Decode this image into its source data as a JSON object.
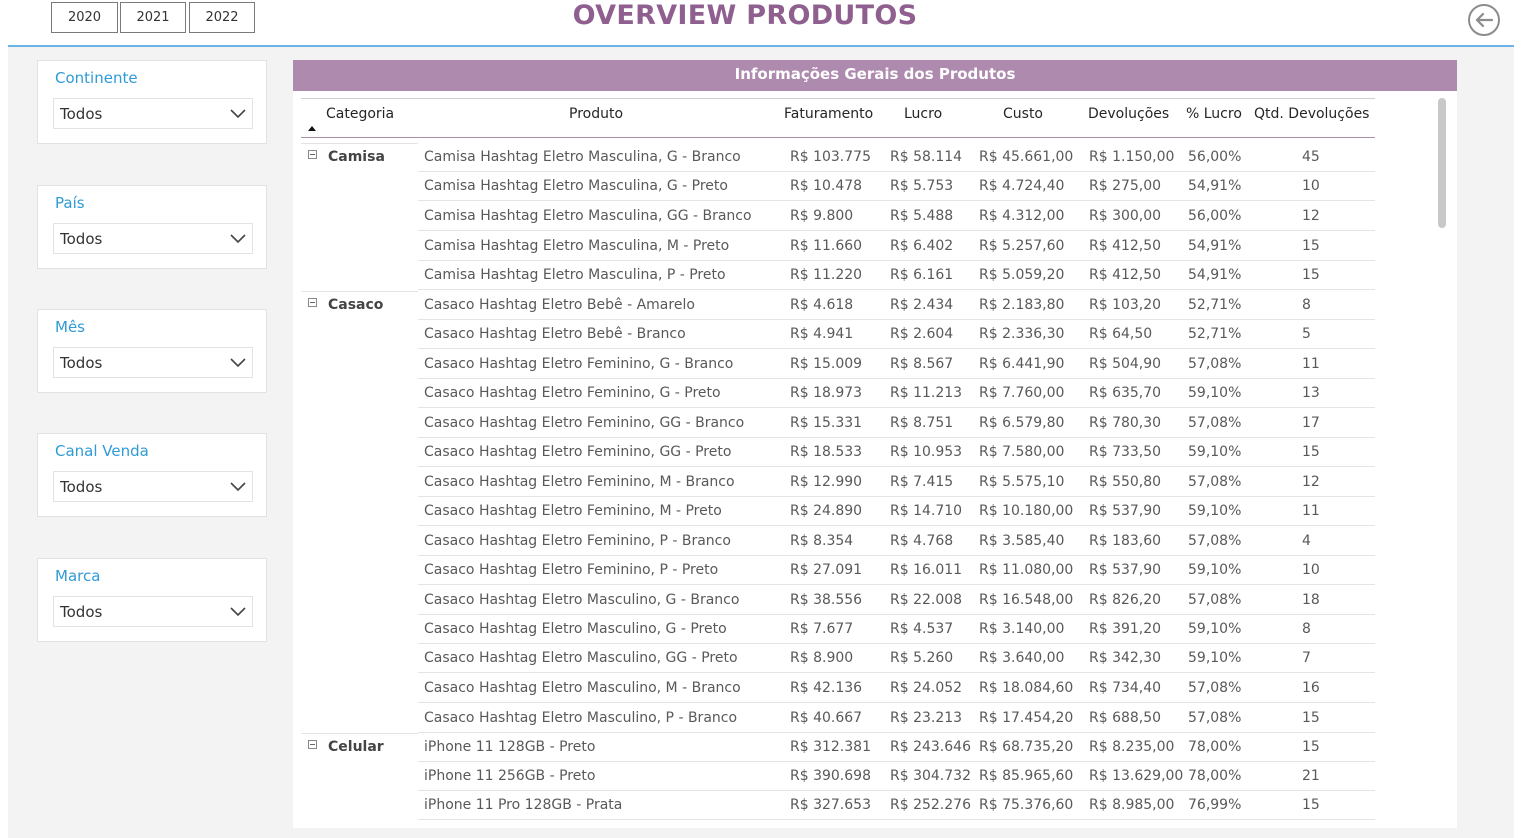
{
  "header": {
    "years": [
      "2020",
      "2021",
      "2022"
    ],
    "title": "OVERVIEW PRODUTOS"
  },
  "filters": [
    {
      "label": "Continente",
      "value": "Todos"
    },
    {
      "label": "País",
      "value": "Todos"
    },
    {
      "label": "Mês",
      "value": "Todos"
    },
    {
      "label": "Canal Venda",
      "value": "Todos"
    },
    {
      "label": "Marca",
      "value": "Todos"
    }
  ],
  "table": {
    "title": "Informações Gerais dos Produtos",
    "columns": [
      "Categoria",
      "Produto",
      "Faturamento",
      "Lucro",
      "Custo",
      "Devoluções",
      "% Lucro",
      "Qtd. Devoluções"
    ],
    "rows": [
      {
        "categoria": "Camisa",
        "produto": "Camisa Hashtag Eletro Masculina, G - Branco",
        "faturamento": "R$ 103.775",
        "lucro": "R$ 58.114",
        "custo": "R$ 45.661,00",
        "devolucoes": "R$ 1.150,00",
        "pct_lucro": "56,00%",
        "qtd_dev": "45"
      },
      {
        "categoria": "",
        "produto": "Camisa Hashtag Eletro Masculina, G - Preto",
        "faturamento": "R$ 10.478",
        "lucro": "R$ 5.753",
        "custo": "R$ 4.724,40",
        "devolucoes": "R$ 275,00",
        "pct_lucro": "54,91%",
        "qtd_dev": "10"
      },
      {
        "categoria": "",
        "produto": "Camisa Hashtag Eletro Masculina, GG - Branco",
        "faturamento": "R$ 9.800",
        "lucro": "R$ 5.488",
        "custo": "R$ 4.312,00",
        "devolucoes": "R$ 300,00",
        "pct_lucro": "56,00%",
        "qtd_dev": "12"
      },
      {
        "categoria": "",
        "produto": "Camisa Hashtag Eletro Masculina, M - Preto",
        "faturamento": "R$ 11.660",
        "lucro": "R$ 6.402",
        "custo": "R$ 5.257,60",
        "devolucoes": "R$ 412,50",
        "pct_lucro": "54,91%",
        "qtd_dev": "15"
      },
      {
        "categoria": "",
        "produto": "Camisa Hashtag Eletro Masculina, P - Preto",
        "faturamento": "R$ 11.220",
        "lucro": "R$ 6.161",
        "custo": "R$ 5.059,20",
        "devolucoes": "R$ 412,50",
        "pct_lucro": "54,91%",
        "qtd_dev": "15"
      },
      {
        "categoria": "Casaco",
        "produto": "Casaco Hashtag Eletro Bebê - Amarelo",
        "faturamento": "R$ 4.618",
        "lucro": "R$ 2.434",
        "custo": "R$ 2.183,80",
        "devolucoes": "R$ 103,20",
        "pct_lucro": "52,71%",
        "qtd_dev": "8"
      },
      {
        "categoria": "",
        "produto": "Casaco Hashtag Eletro Bebê - Branco",
        "faturamento": "R$ 4.941",
        "lucro": "R$ 2.604",
        "custo": "R$ 2.336,30",
        "devolucoes": "R$ 64,50",
        "pct_lucro": "52,71%",
        "qtd_dev": "5"
      },
      {
        "categoria": "",
        "produto": "Casaco Hashtag Eletro Feminino, G - Branco",
        "faturamento": "R$ 15.009",
        "lucro": "R$ 8.567",
        "custo": "R$ 6.441,90",
        "devolucoes": "R$ 504,90",
        "pct_lucro": "57,08%",
        "qtd_dev": "11"
      },
      {
        "categoria": "",
        "produto": "Casaco Hashtag Eletro Feminino, G - Preto",
        "faturamento": "R$ 18.973",
        "lucro": "R$ 11.213",
        "custo": "R$ 7.760,00",
        "devolucoes": "R$ 635,70",
        "pct_lucro": "59,10%",
        "qtd_dev": "13"
      },
      {
        "categoria": "",
        "produto": "Casaco Hashtag Eletro Feminino, GG - Branco",
        "faturamento": "R$ 15.331",
        "lucro": "R$ 8.751",
        "custo": "R$ 6.579,80",
        "devolucoes": "R$ 780,30",
        "pct_lucro": "57,08%",
        "qtd_dev": "17"
      },
      {
        "categoria": "",
        "produto": "Casaco Hashtag Eletro Feminino, GG - Preto",
        "faturamento": "R$ 18.533",
        "lucro": "R$ 10.953",
        "custo": "R$ 7.580,00",
        "devolucoes": "R$ 733,50",
        "pct_lucro": "59,10%",
        "qtd_dev": "15"
      },
      {
        "categoria": "",
        "produto": "Casaco Hashtag Eletro Feminino, M - Branco",
        "faturamento": "R$ 12.990",
        "lucro": "R$ 7.415",
        "custo": "R$ 5.575,10",
        "devolucoes": "R$ 550,80",
        "pct_lucro": "57,08%",
        "qtd_dev": "12"
      },
      {
        "categoria": "",
        "produto": "Casaco Hashtag Eletro Feminino, M - Preto",
        "faturamento": "R$ 24.890",
        "lucro": "R$ 14.710",
        "custo": "R$ 10.180,00",
        "devolucoes": "R$ 537,90",
        "pct_lucro": "59,10%",
        "qtd_dev": "11"
      },
      {
        "categoria": "",
        "produto": "Casaco Hashtag Eletro Feminino, P - Branco",
        "faturamento": "R$ 8.354",
        "lucro": "R$ 4.768",
        "custo": "R$ 3.585,40",
        "devolucoes": "R$ 183,60",
        "pct_lucro": "57,08%",
        "qtd_dev": "4"
      },
      {
        "categoria": "",
        "produto": "Casaco Hashtag Eletro Feminino, P - Preto",
        "faturamento": "R$ 27.091",
        "lucro": "R$ 16.011",
        "custo": "R$ 11.080,00",
        "devolucoes": "R$ 537,90",
        "pct_lucro": "59,10%",
        "qtd_dev": "10"
      },
      {
        "categoria": "",
        "produto": "Casaco Hashtag Eletro Masculino, G - Branco",
        "faturamento": "R$ 38.556",
        "lucro": "R$ 22.008",
        "custo": "R$ 16.548,00",
        "devolucoes": "R$ 826,20",
        "pct_lucro": "57,08%",
        "qtd_dev": "18"
      },
      {
        "categoria": "",
        "produto": "Casaco Hashtag Eletro Masculino, G - Preto",
        "faturamento": "R$ 7.677",
        "lucro": "R$ 4.537",
        "custo": "R$ 3.140,00",
        "devolucoes": "R$ 391,20",
        "pct_lucro": "59,10%",
        "qtd_dev": "8"
      },
      {
        "categoria": "",
        "produto": "Casaco Hashtag Eletro Masculino, GG - Preto",
        "faturamento": "R$ 8.900",
        "lucro": "R$ 5.260",
        "custo": "R$ 3.640,00",
        "devolucoes": "R$ 342,30",
        "pct_lucro": "59,10%",
        "qtd_dev": "7"
      },
      {
        "categoria": "",
        "produto": "Casaco Hashtag Eletro Masculino, M - Branco",
        "faturamento": "R$ 42.136",
        "lucro": "R$ 24.052",
        "custo": "R$ 18.084,60",
        "devolucoes": "R$ 734,40",
        "pct_lucro": "57,08%",
        "qtd_dev": "16"
      },
      {
        "categoria": "",
        "produto": "Casaco Hashtag Eletro Masculino, P - Branco",
        "faturamento": "R$ 40.667",
        "lucro": "R$ 23.213",
        "custo": "R$ 17.454,20",
        "devolucoes": "R$ 688,50",
        "pct_lucro": "57,08%",
        "qtd_dev": "15"
      },
      {
        "categoria": "Celular",
        "produto": "iPhone 11 128GB - Preto",
        "faturamento": "R$ 312.381",
        "lucro": "R$ 243.646",
        "custo": "R$ 68.735,20",
        "devolucoes": "R$ 8.235,00",
        "pct_lucro": "78,00%",
        "qtd_dev": "15"
      },
      {
        "categoria": "",
        "produto": "iPhone 11 256GB - Preto",
        "faturamento": "R$ 390.698",
        "lucro": "R$ 304.732",
        "custo": "R$ 85.965,60",
        "devolucoes": "R$ 13.629,00",
        "pct_lucro": "78,00%",
        "qtd_dev": "21"
      },
      {
        "categoria": "",
        "produto": "iPhone 11 Pro 128GB - Prata",
        "faturamento": "R$ 327.653",
        "lucro": "R$ 252.276",
        "custo": "R$ 75.376,60",
        "devolucoes": "R$ 8.985,00",
        "pct_lucro": "76,99%",
        "qtd_dev": "15"
      }
    ]
  },
  "colors": {
    "title": "#8f5f8f",
    "table_header": "#ae8aae",
    "filter_label": "#2f9bd6",
    "header_line": "#6ab4e8"
  },
  "icons": {
    "back": "arrow-left-circle-icon",
    "dropdown": "chevron-down-icon",
    "collapse": "minus-square-icon"
  }
}
